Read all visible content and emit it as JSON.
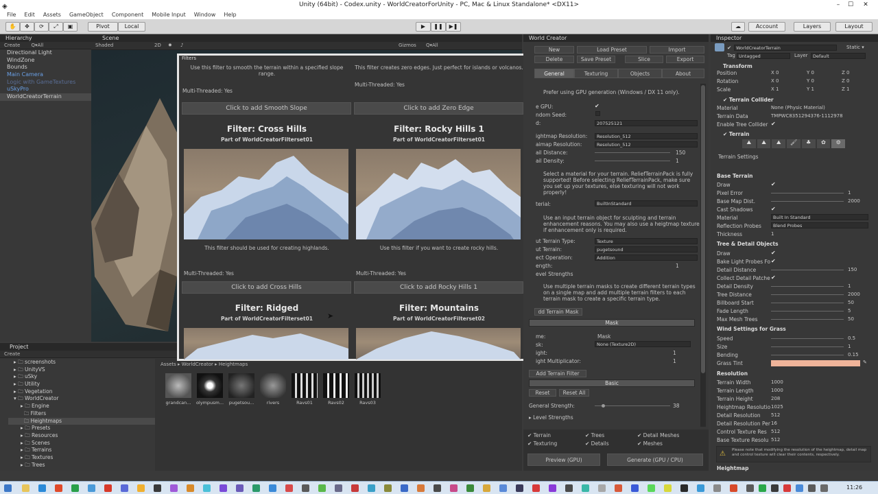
{
  "window": {
    "title": "Unity (64bit) - Codex.unity - WorldCreatorForUnity - PC, Mac & Linux Standalone* <DX11>",
    "min": "–",
    "max": "☐",
    "close": "✕"
  },
  "menu": [
    "File",
    "Edit",
    "Assets",
    "GameObject",
    "Component",
    "Mobile Input",
    "Window",
    "Help"
  ],
  "toolbar": {
    "pivot": "Pivot",
    "local": "Local",
    "account": "Account",
    "layers": "Layers",
    "layout": "Layout"
  },
  "hierarchy": {
    "tab": "Hierarchy",
    "create": "Create",
    "search": "Q▾All",
    "items": [
      "Directional Light",
      "WindZone",
      "Bounds",
      "Main Camera",
      "Logic with GameTextures",
      "uSkyPro",
      "WorldCreatorTerrain"
    ]
  },
  "scene": {
    "tab": "Scene",
    "shaded": "Shaded",
    "mode_2d": "2D",
    "gizmos": "Gizmos",
    "search": "Q▾All"
  },
  "filters_window": {
    "title": "Filters",
    "top_left_desc": "Use this filter to smooth the terrain within a specified slope range.",
    "top_right_desc": "This filter creates zero edges. Just perfect for islands or volcanos.",
    "cards": [
      {
        "mt": "Multi-Threaded: Yes",
        "button": "Click to add Smooth Slope"
      },
      {
        "mt": "Multi-Threaded: Yes",
        "button": "Click to add Zero Edge"
      },
      {
        "title": "Filter: Cross Hills",
        "sub": "Part of WorldCreatorFilterset01",
        "desc": "This filter should be used for creating highlands.",
        "mt": "Multi-Threaded: Yes",
        "button": "Click to add Cross Hills"
      },
      {
        "title": "Filter: Rocky Hills 1",
        "sub": "Part of WorldCreatorFilterset01",
        "desc": "Use this filter if you want to create rocky hills.",
        "mt": "Multi-Threaded: Yes",
        "button": "Click to add Rocky Hills 1"
      },
      {
        "title": "Filter: Ridged",
        "sub": "Part of WorldCreatorFilterset01"
      },
      {
        "title": "Filter: Mountains",
        "sub": "Part of WorldCreatorFilterset02"
      }
    ]
  },
  "project": {
    "tab": "Project",
    "create": "Create",
    "tree": [
      "screenshots",
      "UnityVS",
      "uSky",
      "Utility",
      "Vegetation",
      "WorldCreator",
      "Engine",
      "Filters",
      "Heightmaps",
      "Presets",
      "Resources",
      "Scenes",
      "Terrains",
      "Textures",
      "Trees"
    ],
    "breadcrumb": "Assets ▸ WorldCreator ▸ Heightmaps",
    "assets": [
      "grandcan...",
      "olympusm...",
      "pugetsou...",
      "rivers",
      "Ravs01",
      "Ravs02",
      "Ravs03"
    ]
  },
  "world_creator": {
    "tab": "World Creator",
    "buttons": [
      "New",
      "Load Preset",
      "Import",
      "Delete",
      "Save Preset",
      "Slice",
      "Export"
    ],
    "tabs": [
      "General",
      "Texturing",
      "Objects",
      "About"
    ],
    "gpu_note": "Prefer using GPU generation (Windows / DX 11 only).",
    "rows": [
      {
        "label": "e GPU:",
        "value": "✔"
      },
      {
        "label": "ndom Seed:",
        "value": ""
      },
      {
        "label": "d:",
        "value": "207525121"
      },
      {
        "label": "ightmap Resolution:",
        "value": "Resolution_512"
      },
      {
        "label": "aimap Resolution:",
        "value": "Resolution_512"
      },
      {
        "label": "ail Distance:",
        "value": "150"
      },
      {
        "label": "ail Density:",
        "value": "1"
      }
    ],
    "material_note": "Select a material for your terrain. ReliefTerrainPack is fully supported! Before selecting ReliefTerrainPack, make sure you set up your textures, else texturing will not work properly!",
    "material_label": "terial:",
    "material_value": "BuiltInStandard",
    "input_note": "Use an input terrain object for sculpting and terrain enhancement reasons. You may also use a heigtmap texture if enhancement only is required.",
    "input_rows": [
      {
        "label": "ut Terrain Type:",
        "value": "Texture"
      },
      {
        "label": "ut Terrain:",
        "value": "pugetsound"
      },
      {
        "label": "ect Operation:",
        "value": "Addition"
      },
      {
        "label": "ength:",
        "value": "1"
      }
    ],
    "level_strengths": "evel Strengths",
    "mask_note": "Use multiple terrain masks to create different terrain types on a single map and add multiple terrain filters to each terrain mask to create a specific terrain type.",
    "add_mask": "dd Terrain Mask",
    "mask_bar": "Mask",
    "mask_rows": [
      {
        "label": "me:",
        "value": "Mask"
      },
      {
        "label": "sk:",
        "value": "None (Texture2D)"
      },
      {
        "label": "ight:",
        "value": "1"
      },
      {
        "label": "ight Multiplicator:",
        "value": "1"
      }
    ],
    "add_filter": "Add Terrain Filter",
    "basic_bar": "Basic",
    "reset": "Reset",
    "reset_all": "Reset All",
    "general_strength": "General Strength:",
    "general_strength_value": "38",
    "level_strengths2": "Level Strengths",
    "checks": [
      "Terrain",
      "Trees",
      "Detail Meshes",
      "Texturing",
      "Details",
      "Meshes"
    ],
    "preview": "Preview (GPU)",
    "generate": "Generate (GPU / CPU)"
  },
  "inspector": {
    "tab": "Inspector",
    "object": "WorldCreatorTerrain",
    "static": "Static ▾",
    "tag_label": "Tag",
    "tag": "Untagged",
    "layer_label": "Layer",
    "layer": "Default",
    "transform": "Transform",
    "pos": [
      "Position",
      "X 0",
      "Y 0",
      "Z 0"
    ],
    "rot": [
      "Rotation",
      "X 0",
      "Y 0",
      "Z 0"
    ],
    "scl": [
      "Scale",
      "X 1",
      "Y 1",
      "Z 1"
    ],
    "collider": "Terrain Collider",
    "material_label": "Material",
    "material": "None (Physic Material)",
    "terraindata_label": "Terrain Data",
    "terraindata": "TMPWC8351294376-1112978",
    "enable_tree": "Enable Tree Collider",
    "terrain": "Terrain",
    "terrain_settings": "Terrain Settings",
    "base_terrain": "Base Terrain",
    "base_rows": [
      {
        "label": "Draw",
        "value": "✔"
      },
      {
        "label": "Pixel Error",
        "value": "1"
      },
      {
        "label": "Base Map Dist.",
        "value": "2000"
      },
      {
        "label": "Cast Shadows",
        "value": "✔"
      },
      {
        "label": "Material",
        "value": "Built In Standard"
      },
      {
        "label": "Reflection Probes",
        "value": "Blend Probes"
      },
      {
        "label": "Thickness",
        "value": "1"
      }
    ],
    "tree_detail": "Tree & Detail Objects",
    "tree_rows": [
      {
        "label": "Draw",
        "value": "✔"
      },
      {
        "label": "Bake Light Probes Fo",
        "value": "✔"
      },
      {
        "label": "Detail Distance",
        "value": "150"
      },
      {
        "label": "Collect Detail Patche",
        "value": "✔"
      },
      {
        "label": "Detail Density",
        "value": "1"
      },
      {
        "label": "Tree Distance",
        "value": "2000"
      },
      {
        "label": "Billboard Start",
        "value": "50"
      },
      {
        "label": "Fade Length",
        "value": "5"
      },
      {
        "label": "Max Mesh Trees",
        "value": "50"
      }
    ],
    "wind": "Wind Settings for Grass",
    "wind_rows": [
      {
        "label": "Speed",
        "value": "0.5"
      },
      {
        "label": "Size",
        "value": "1"
      },
      {
        "label": "Bending",
        "value": "0.15"
      },
      {
        "label": "Grass Tint",
        "value": ""
      }
    ],
    "resolution": "Resolution",
    "res_rows": [
      {
        "label": "Terrain Width",
        "value": "1000"
      },
      {
        "label": "Terrain Length",
        "value": "1000"
      },
      {
        "label": "Terrain Height",
        "value": "208"
      },
      {
        "label": "Heightmap Resolutio",
        "value": "1025"
      },
      {
        "label": "Detail Resolution",
        "value": "512"
      },
      {
        "label": "Detail Resolution Per",
        "value": "16"
      },
      {
        "label": "Control Texture Res",
        "value": "512"
      },
      {
        "label": "Base Texture Resolu",
        "value": "512"
      }
    ],
    "warning": "Please note that modifying the resolution of the heightmap, detail map and control texture will clear their contents, respectively.",
    "heightmap": "Heightmap"
  },
  "taskbar": {
    "clock": "11:26"
  },
  "colors": {
    "accent_blue": "#3d6fc4",
    "grass_tint": "#f0b49a",
    "panel": "#383838"
  }
}
